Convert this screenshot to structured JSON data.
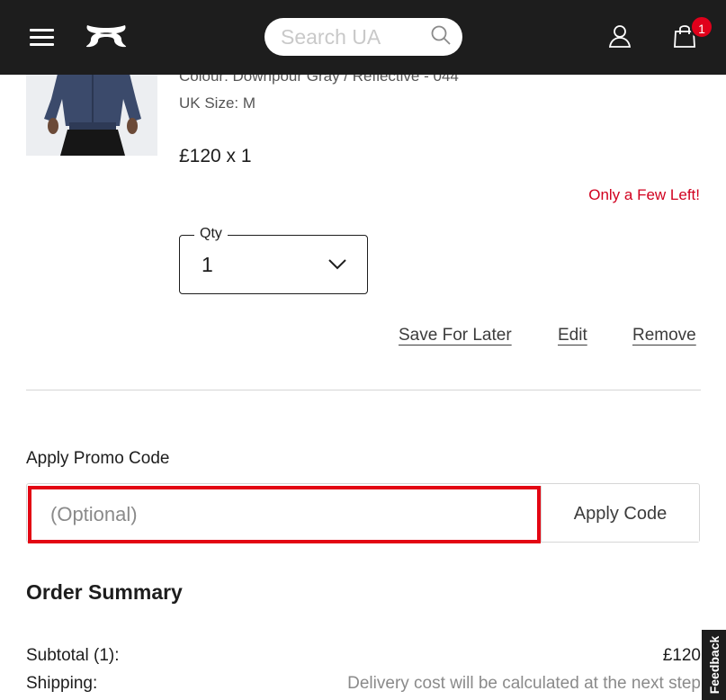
{
  "header": {
    "search": {
      "placeholder": "Search UA",
      "value": ""
    },
    "cart_count": "1"
  },
  "product": {
    "colour": "Colour: Downpour Gray / Reflective - 044",
    "size": "UK Size: M",
    "price": "£120 x 1",
    "stock_message": "Only a Few Left!",
    "qty_label": "Qty",
    "qty_value": "1",
    "actions": {
      "save": "Save For Later",
      "edit": "Edit",
      "remove": "Remove"
    }
  },
  "promo": {
    "title": "Apply Promo Code",
    "placeholder": "(Optional)",
    "value": "",
    "button": "Apply Code"
  },
  "summary": {
    "title": "Order Summary",
    "subtotal_label": "Subtotal (1):",
    "subtotal_value": "£120",
    "shipping_label": "Shipping:",
    "shipping_value": "Delivery cost will be calculated at the next step"
  },
  "feedback": "Feedback",
  "colors": {
    "header_bg": "#1d1d1d",
    "accent_red": "#e0001b",
    "highlight_border": "#e30613"
  }
}
